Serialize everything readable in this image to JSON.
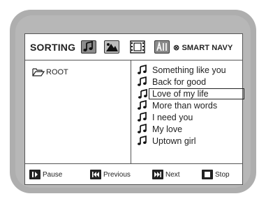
{
  "header": {
    "title": "SORTING",
    "brand": "⊗ SMART NAVY",
    "tabs": [
      "music",
      "photo",
      "movie",
      "all"
    ]
  },
  "left_pane": {
    "root_label": "ROOT",
    "root_icon": "folder-open-icon"
  },
  "songs": [
    {
      "label": "Something like you",
      "selected": false
    },
    {
      "label": "Back for good",
      "selected": false
    },
    {
      "label": "Love of my life",
      "selected": true
    },
    {
      "label": "More than words",
      "selected": false
    },
    {
      "label": "I need you",
      "selected": false
    },
    {
      "label": "My love",
      "selected": false
    },
    {
      "label": "Uptown girl",
      "selected": false
    }
  ],
  "footer": {
    "pause": "Pause",
    "previous": "Previous",
    "next": "Next",
    "stop": "Stop"
  },
  "colors": {
    "frame": "#aeaeae",
    "screen": "#ffffff",
    "tab_dark": "#8b8b8b",
    "tab_light": "#bdbdbd",
    "text": "#222222"
  }
}
